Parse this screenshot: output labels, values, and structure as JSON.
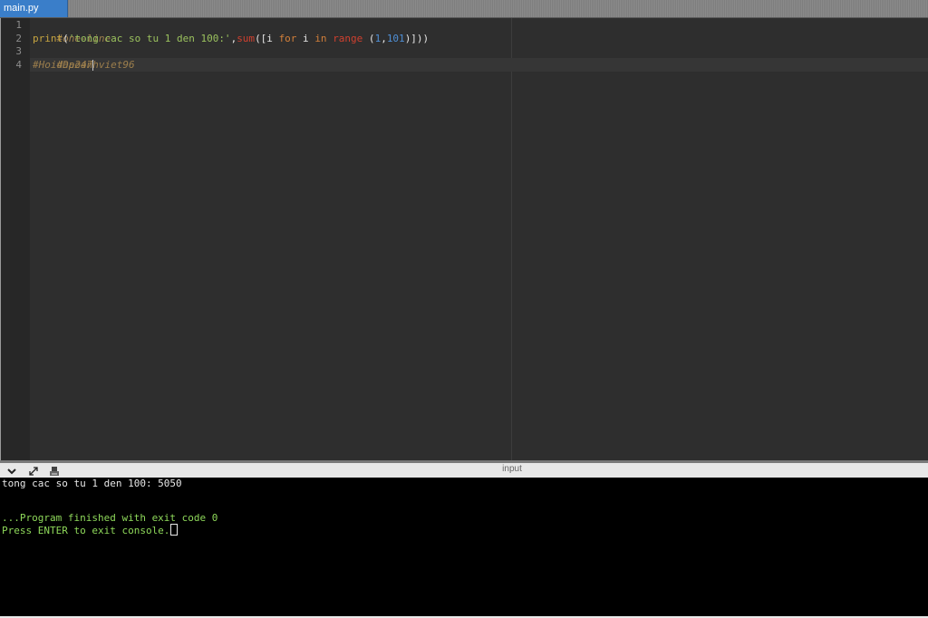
{
  "tabs": [
    {
      "label": "main.py",
      "active": true
    }
  ],
  "editor": {
    "line_numbers": [
      "1",
      "2",
      "3",
      "4"
    ],
    "lines": {
      "l1": {
        "comment": "#one-line"
      },
      "l2": {
        "fn": "print",
        "open": "(",
        "string": "'tong cac so tu 1 den 100:'",
        "comma": ",",
        "builtin": "sum",
        "mid1": "([i ",
        "kw_for": "for",
        "mid2": " i ",
        "kw_in": "in",
        "space": " ",
        "kw_range": "range",
        "mid3": " (",
        "num1": "1",
        "comma2": ",",
        "num2": "101",
        "close": ")]))"
      },
      "l3": {
        "comment": "#Daoanhviet96"
      },
      "l4": {
        "comment": "#Hoidap247"
      }
    }
  },
  "console_toolbar": {
    "collapse_icon": "chevron-down-icon",
    "expand_icon": "expand-arrows-icon",
    "clear_icon": "clear-console-icon",
    "input_label": "input"
  },
  "console": {
    "output_line": "tong cac so tu 1 den 100: 5050",
    "finished_line": "...Program finished with exit code 0",
    "press_enter_line": "Press ENTER to exit console."
  },
  "colors": {
    "tab_active": "#3a7ec9",
    "editor_bg": "#2e2e2e",
    "console_bg": "#000000",
    "console_green": "#8ed85a"
  }
}
